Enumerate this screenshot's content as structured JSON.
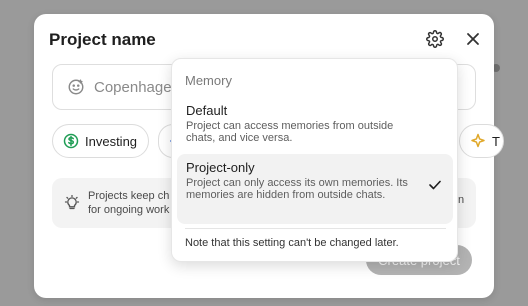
{
  "modal": {
    "title": "Project name",
    "name_input": {
      "value": "Copenhagen"
    },
    "chips": [
      {
        "label": "Investing",
        "icon": "dollar-circle-icon"
      },
      {
        "label": "",
        "icon": "partial-chip-icon"
      },
      {
        "label": "T",
        "icon": "sparkle-icon"
      }
    ],
    "tip": {
      "line1": "Projects keep ch",
      "line2": "for ongoing work",
      "trailing": "n",
      "icon": "lightbulb-icon"
    },
    "create_button_label": "Create project",
    "icons": {
      "settings": "gear-icon",
      "close": "close-icon"
    }
  },
  "menu": {
    "header": "Memory",
    "options": [
      {
        "title": "Default",
        "description": "Project can access memories from outside chats, and vice versa.",
        "selected": false
      },
      {
        "title": "Project-only",
        "description": "Project can only access its own memories. Its memories are hidden from outside chats.",
        "selected": true
      }
    ],
    "note": "Note that this setting can't be changed later."
  },
  "colors": {
    "backdrop": "#9a9a9a",
    "investing_icon": "#1f9d55",
    "sparkle_icon": "#e0a829"
  }
}
